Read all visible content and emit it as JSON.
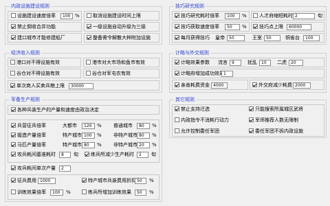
{
  "g1": {
    "title": "内政设施建设规则",
    "cb1": {
      "label": "设施建设速度倍率",
      "checked": false
    },
    "v1": "100",
    "u1": "%",
    "cb2": {
      "label": "取消设施建设时间上限",
      "checked": false
    },
    "cb3": {
      "label": "禁止倒收合并功能",
      "checked": true
    },
    "cb4": {
      "label": "一级设施自动升级为三级",
      "checked": true
    },
    "cb5": {
      "label": "建口城市才能修建船厂",
      "checked": true
    },
    "cb6": {
      "label": "整备需令解散大种附加设施",
      "checked": true
    }
  },
  "g2": {
    "title": "技巧研究规则",
    "cb1": {
      "label": "技巧研究耗时倍率",
      "checked": true
    },
    "v1": "100",
    "u1": "%",
    "cb2": {
      "label": "人才府缩短耗时",
      "checked": false
    },
    "v2": "2",
    "u2": "旬",
    "cb3": {
      "label": "技巧获取速度倍率",
      "checked": true
    },
    "v3": "50",
    "u3": "%",
    "cb4": {
      "label": "技巧点上限",
      "checked": true
    },
    "v4": "60000",
    "cb5": {
      "label": "每月获得技巧",
      "checked": true
    },
    "l1": "皇帝",
    "v5": "50",
    "l2": "王室",
    "v6": "50",
    "l3": "铜雀台",
    "v7": "100"
  },
  "g3": {
    "title": "经济收入规则",
    "cb1": {
      "label": "港口对不得设施有效",
      "checked": false
    },
    "cb2": {
      "label": "港市对大市场和鱼市有效",
      "checked": false
    },
    "cb3": {
      "label": "谷仓对不得设施有效",
      "checked": false
    },
    "cb4": {
      "label": "谷仓对军屯农有效",
      "checked": false
    },
    "cb5": {
      "label": "单次商人买卖兵粮上限",
      "checked": true
    },
    "v1": "30000"
  },
  "g4": {
    "title": "计略与外交规则",
    "cb1": {
      "label": "计略效果参数",
      "checked": true
    },
    "l1": "流言",
    "v1": "9",
    "l2": "扰乱",
    "v2": "10",
    "l3": "二虎",
    "v3": "20",
    "cb2": {
      "label": "计略府增加成功效果",
      "checked": true
    },
    "v4": "1",
    "cb3": {
      "label": "亲善耗费资金",
      "checked": true
    },
    "v5": "4000",
    "cb4": {
      "label": "外交府减少耗费",
      "checked": true
    },
    "v6": "2000"
  },
  "g5": {
    "title": "军备生产规则",
    "cb1": {
      "label": "各种兵装生产的产量和速度由政治决定",
      "checked": true
    },
    "cb2": {
      "label": "兵营征兵倍率",
      "checked": true
    },
    "l1": "大都市",
    "v1": "120",
    "l2": "普通城市",
    "v2": "80",
    "cb3": {
      "label": "锻造产量倍率",
      "checked": true
    },
    "l3": "特产城市",
    "v3": "100",
    "l4": "非特产城市",
    "v4": "80",
    "cb4": {
      "label": "马匹产量倍率",
      "checked": true
    },
    "l5": "特产城市",
    "v5": "80",
    "l6": "非特产城市",
    "v6": "20",
    "cb5": {
      "label": "攻兵耗间基准耗时",
      "checked": true
    },
    "v7": "8",
    "u7": "旬",
    "cb6": {
      "label": "练兵所减少生产耗时",
      "checked": true
    },
    "v8": "2",
    "u8": "旬",
    "cb7": {
      "label": "攻兵耗间单次产量",
      "checked": true
    },
    "v9": "2",
    "cb8": {
      "label": "征兵费用",
      "checked": true
    },
    "v10": "1000",
    "cb9": {
      "label": "特产城市兵装费用折扣",
      "checked": true
    },
    "v11": "50",
    "u11": "%",
    "cb10": {
      "label": "训练效果倍率",
      "checked": false
    },
    "v12": "100",
    "u12": "%",
    "cb11": {
      "label": "练兵所增加训练效果",
      "checked": false
    },
    "v13": "50",
    "u13": "%",
    "pct": "%"
  },
  "g6": {
    "title": "其它规则",
    "cb1": {
      "label": "禁止支持迁选",
      "checked": true
    },
    "cb2": {
      "label": "只能搜索所属城区武将",
      "checked": true
    },
    "cb3": {
      "label": "内政指令不消耗行动力",
      "checked": false
    },
    "cb4": {
      "label": "军师推荐人数无限制",
      "checked": true
    },
    "cb5": {
      "label": "允许控制委任军团",
      "checked": false
    },
    "cb6": {
      "label": "委任军团不拆内政设施",
      "checked": true
    }
  }
}
